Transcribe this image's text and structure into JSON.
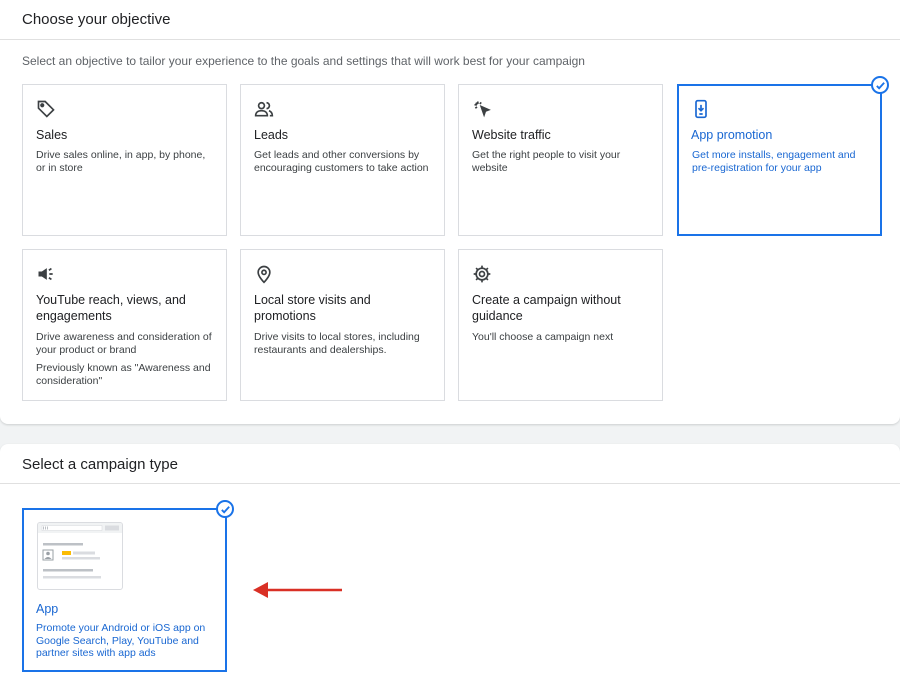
{
  "objective": {
    "title": "Choose your objective",
    "subtitle": "Select an objective to tailor your experience to the goals and settings that will work best for your campaign",
    "cards": [
      {
        "title": "Sales",
        "desc": "Drive sales online, in app, by phone, or in store",
        "icon": "tag-icon"
      },
      {
        "title": "Leads",
        "desc": "Get leads and other conversions by encouraging customers to take action",
        "icon": "people-icon"
      },
      {
        "title": "Website traffic",
        "desc": "Get the right people to visit your website",
        "icon": "cursor-click-icon"
      },
      {
        "title": "App promotion",
        "desc": "Get more installs, engagement and pre-registration for your app",
        "icon": "phone-download-icon",
        "selected": true
      },
      {
        "title": "YouTube reach, views, and engagements",
        "desc": "Drive awareness and consideration of your product or brand",
        "note": "Previously known as \"Awareness and consideration\"",
        "icon": "megaphone-icon"
      },
      {
        "title": "Local store visits and promotions",
        "desc": "Drive visits to local stores, including restaurants and dealerships.",
        "icon": "location-pin-icon"
      },
      {
        "title": "Create a campaign without guidance",
        "desc": "You'll choose a campaign next",
        "icon": "gear-icon"
      }
    ]
  },
  "campaign_type": {
    "title": "Select a campaign type",
    "card": {
      "title": "App",
      "desc": "Promote your Android or iOS app on Google Search, Play, YouTube and partner sites with app ads",
      "selected": true
    }
  },
  "colors": {
    "accent": "#1a73e8",
    "arrow": "#d93025"
  }
}
